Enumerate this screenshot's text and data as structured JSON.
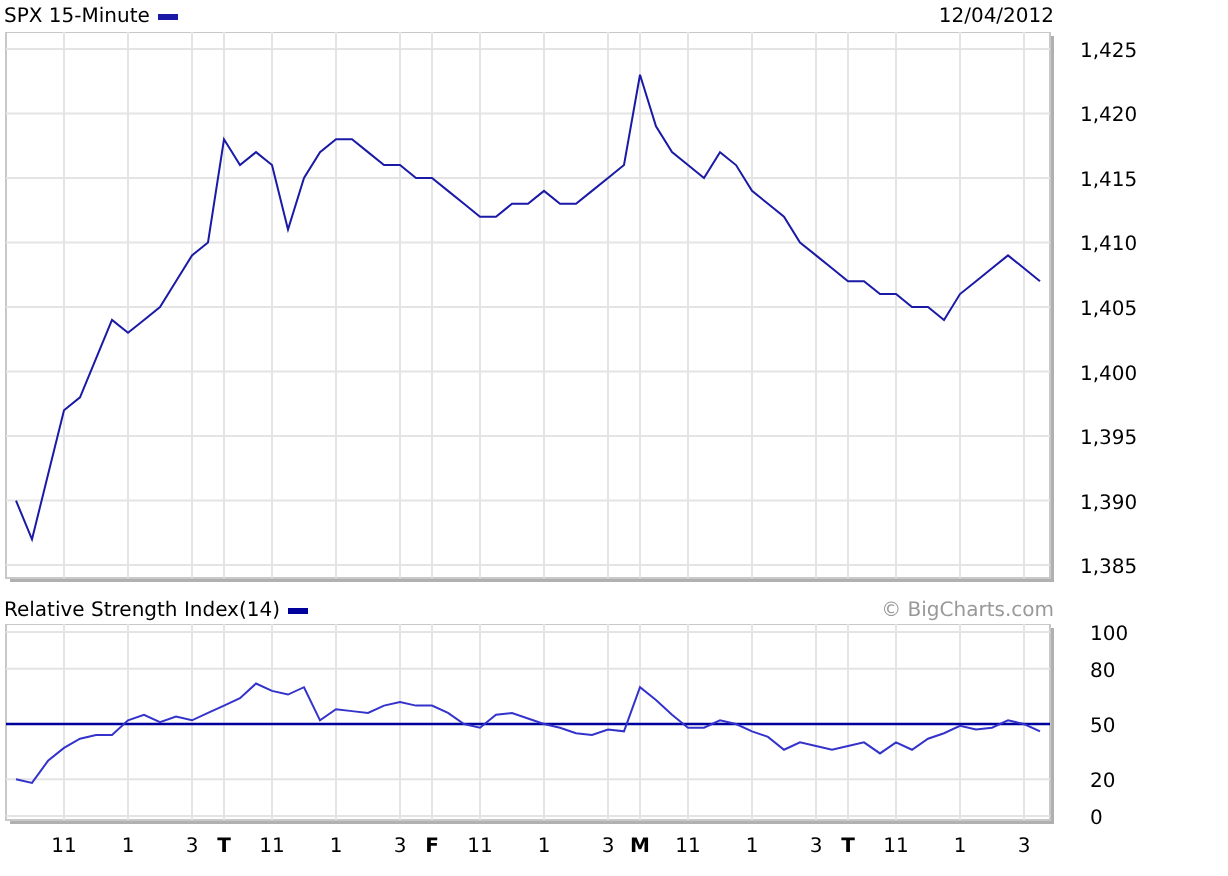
{
  "price_panel": {
    "title": "SPX 15-Minute",
    "date": "12/04/2012",
    "chart_data": {
      "type": "line",
      "series": [
        {
          "color": "#1a1aa6",
          "values": [
            1390,
            1387,
            1392,
            1397,
            1398,
            1401,
            1404,
            1403,
            1404,
            1405,
            1407,
            1409,
            1410,
            1418,
            1416,
            1417,
            1416,
            1411,
            1415,
            1417,
            1418,
            1418,
            1417,
            1416,
            1416,
            1415,
            1415,
            1414,
            1413,
            1412,
            1412,
            1413,
            1413,
            1414,
            1413,
            1413,
            1414,
            1415,
            1416,
            1423,
            1419,
            1417,
            1416,
            1415,
            1417,
            1416,
            1414,
            1413,
            1412,
            1410,
            1409,
            1408,
            1407,
            1407,
            1406,
            1406,
            1405,
            1405,
            1404,
            1406,
            1407,
            1408,
            1409,
            1408,
            1407
          ]
        }
      ],
      "ylim": [
        1384,
        1426
      ],
      "grid": true,
      "yticks": [
        {
          "value": 1425,
          "label": "1,425"
        },
        {
          "value": 1420,
          "label": "1,420"
        },
        {
          "value": 1415,
          "label": "1,415"
        },
        {
          "value": 1410,
          "label": "1,410"
        },
        {
          "value": 1405,
          "label": "1,405"
        },
        {
          "value": 1400,
          "label": "1,400"
        },
        {
          "value": 1395,
          "label": "1,395"
        },
        {
          "value": 1390,
          "label": "1,390"
        },
        {
          "value": 1385,
          "label": "1,385"
        }
      ]
    }
  },
  "rsi_panel": {
    "title": "Relative Strength Index(14)",
    "credit": "© BigCharts.com",
    "chart_data": {
      "type": "line",
      "categories": [
        null,
        null,
        null,
        "11",
        null,
        null,
        null,
        "1",
        null,
        null,
        null,
        "3",
        null,
        "T",
        null,
        null,
        "11",
        null,
        null,
        null,
        "1",
        null,
        null,
        null,
        "3",
        null,
        "F",
        null,
        null,
        "11",
        null,
        null,
        null,
        "1",
        null,
        null,
        null,
        "3",
        null,
        "M",
        null,
        null,
        "11",
        null,
        null,
        null,
        "1",
        null,
        null,
        null,
        "3",
        null,
        "T",
        null,
        null,
        "11",
        null,
        null,
        null,
        "1",
        null,
        null,
        null,
        "3",
        null
      ],
      "series": [
        {
          "color": "#3333cc",
          "values": [
            20,
            18,
            30,
            37,
            42,
            44,
            44,
            52,
            55,
            51,
            54,
            52,
            56,
            60,
            64,
            72,
            68,
            66,
            70,
            52,
            58,
            57,
            56,
            60,
            62,
            60,
            60,
            56,
            50,
            48,
            55,
            56,
            53,
            50,
            48,
            45,
            44,
            47,
            46,
            70,
            63,
            55,
            48,
            48,
            52,
            50,
            46,
            43,
            36,
            40,
            38,
            36,
            38,
            40,
            34,
            40,
            36,
            42,
            45,
            49,
            47,
            48,
            52,
            50,
            46
          ]
        }
      ],
      "ylim": [
        0,
        100
      ],
      "grid": true,
      "yticks": [
        100,
        80,
        50,
        20,
        0
      ],
      "ref_lines": [
        {
          "axis": "y",
          "value": 50
        }
      ]
    }
  }
}
